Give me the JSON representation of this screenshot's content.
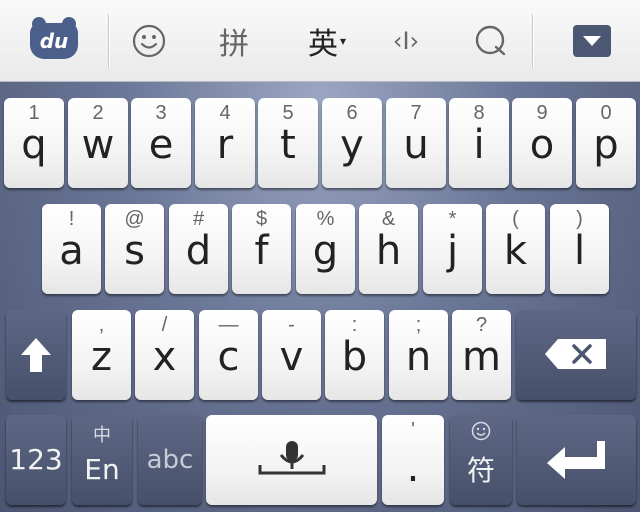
{
  "toolbar": {
    "logo_text": "du",
    "pinyin_label": "拼",
    "english_label": "英",
    "english_caret": "▾",
    "cursor_label": "‹I›"
  },
  "rows": {
    "row1": [
      {
        "char": "q",
        "sub": "1"
      },
      {
        "char": "w",
        "sub": "2"
      },
      {
        "char": "e",
        "sub": "3"
      },
      {
        "char": "r",
        "sub": "4"
      },
      {
        "char": "t",
        "sub": "5"
      },
      {
        "char": "y",
        "sub": "6"
      },
      {
        "char": "u",
        "sub": "7"
      },
      {
        "char": "i",
        "sub": "8"
      },
      {
        "char": "o",
        "sub": "9"
      },
      {
        "char": "p",
        "sub": "0"
      }
    ],
    "row2": [
      {
        "char": "a",
        "sub": "!"
      },
      {
        "char": "s",
        "sub": "@"
      },
      {
        "char": "d",
        "sub": "#"
      },
      {
        "char": "f",
        "sub": "$"
      },
      {
        "char": "g",
        "sub": "%"
      },
      {
        "char": "h",
        "sub": "&"
      },
      {
        "char": "j",
        "sub": "*"
      },
      {
        "char": "k",
        "sub": "("
      },
      {
        "char": "l",
        "sub": ")"
      }
    ],
    "row3": [
      {
        "char": "z",
        "sub": ","
      },
      {
        "char": "x",
        "sub": "/"
      },
      {
        "char": "c",
        "sub": "—"
      },
      {
        "char": "v",
        "sub": "-"
      },
      {
        "char": "b",
        "sub": ":"
      },
      {
        "char": "n",
        "sub": ";"
      },
      {
        "char": "m",
        "sub": "?"
      }
    ]
  },
  "bottom": {
    "num_label": "123",
    "lang_top": "中",
    "lang_bottom": "En",
    "abc_label": "abc",
    "period_sub": "'",
    "period_label": ".",
    "symbol_label": "符"
  }
}
